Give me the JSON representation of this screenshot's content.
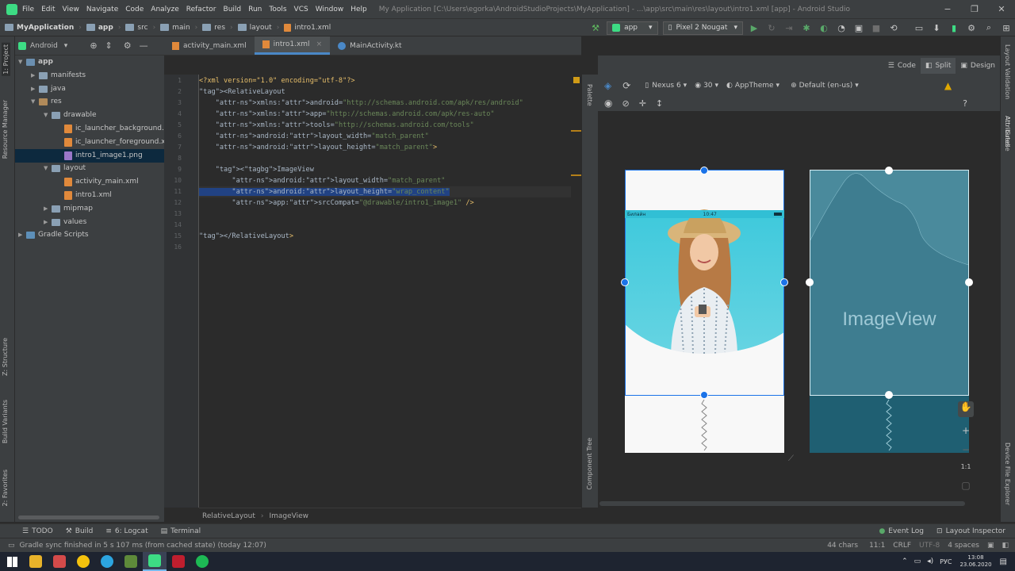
{
  "window": {
    "menu": [
      "File",
      "Edit",
      "View",
      "Navigate",
      "Code",
      "Analyze",
      "Refactor",
      "Build",
      "Run",
      "Tools",
      "VCS",
      "Window",
      "Help"
    ],
    "title": "My Application [C:\\Users\\egorka\\AndroidStudioProjects\\MyApplication] - ...\\app\\src\\main\\res\\layout\\intro1.xml [app] - Android Studio",
    "controls": {
      "minimize": "−",
      "maximize": "❐",
      "close": "✕"
    }
  },
  "navbar": {
    "breadcrumb": [
      "MyApplication",
      "app",
      "src",
      "main",
      "res",
      "layout",
      "intro1.xml"
    ],
    "run_config": "app",
    "device": "Pixel 2 Nougat"
  },
  "left_toolwindows": [
    "1: Project",
    "Resource Manager",
    "Z: Structure",
    "Build Variants",
    "2: Favorites"
  ],
  "right_toolwindows": [
    "Layout Validation",
    "Attributes",
    "Gradle",
    "Device File Explorer"
  ],
  "project": {
    "view": "Android",
    "tree": [
      {
        "label": "app",
        "depth": 0,
        "expanded": true,
        "kind": "module"
      },
      {
        "label": "manifests",
        "depth": 1,
        "expanded": false,
        "kind": "folder"
      },
      {
        "label": "java",
        "depth": 1,
        "expanded": false,
        "kind": "folder"
      },
      {
        "label": "res",
        "depth": 1,
        "expanded": true,
        "kind": "res"
      },
      {
        "label": "drawable",
        "depth": 2,
        "expanded": true,
        "kind": "folder"
      },
      {
        "label": "ic_launcher_background.xml",
        "depth": 3,
        "kind": "xml"
      },
      {
        "label": "ic_launcher_foreground.xml",
        "depth": 3,
        "kind": "xml"
      },
      {
        "label": "intro1_image1.png",
        "depth": 3,
        "kind": "png",
        "selected": true
      },
      {
        "label": "layout",
        "depth": 2,
        "expanded": true,
        "kind": "folder"
      },
      {
        "label": "activity_main.xml",
        "depth": 3,
        "kind": "xml"
      },
      {
        "label": "intro1.xml",
        "depth": 3,
        "kind": "xml"
      },
      {
        "label": "mipmap",
        "depth": 2,
        "expanded": false,
        "kind": "folder"
      },
      {
        "label": "values",
        "depth": 2,
        "expanded": false,
        "kind": "folder"
      },
      {
        "label": "Gradle Scripts",
        "depth": 0,
        "expanded": false,
        "kind": "gradle"
      }
    ]
  },
  "editor_tabs": [
    {
      "label": "activity_main.xml",
      "active": false
    },
    {
      "label": "intro1.xml",
      "active": true
    },
    {
      "label": "MainActivity.kt",
      "active": false
    }
  ],
  "code": {
    "line_numbers": [
      "1",
      "2",
      "3",
      "4",
      "5",
      "6",
      "7",
      "8",
      "9",
      "10",
      "11",
      "12",
      "13",
      "14",
      "15",
      "16"
    ],
    "lines": [
      "<?xml version=\"1.0\" encoding=\"utf-8\"?>",
      "<RelativeLayout",
      "    xmlns:android=\"http://schemas.android.com/apk/res/android\"",
      "    xmlns:app=\"http://schemas.android.com/apk/res-auto\"",
      "    xmlns:tools=\"http://schemas.android.com/tools\"",
      "    android:layout_width=\"match_parent\"",
      "    android:layout_height=\"match_parent\">",
      "",
      "    <ImageView",
      "        android:layout_width=\"match_parent\"",
      "        android:layout_height=\"wrap_content\"",
      "        app:srcCompat=\"@drawable/intro1_image1\" />",
      "",
      "",
      "</RelativeLayout>",
      ""
    ]
  },
  "editor_breadcrumb": [
    "RelativeLayout",
    "ImageView"
  ],
  "design": {
    "modes": [
      "Code",
      "Split",
      "Design"
    ],
    "active_mode": "Split",
    "toolbar": {
      "device": "Nexus 6",
      "api": "30",
      "theme": "AppTheme",
      "locale": "Default (en-us)"
    },
    "strips": {
      "palette": "Palette",
      "component_tree": "Component Tree"
    },
    "phone_status": {
      "carrier": "Билайн",
      "time": "10:47"
    },
    "blueprint_label": "ImageView",
    "zoom_controls": [
      "+",
      "−",
      "1:1"
    ]
  },
  "bottom_tools": [
    "TODO",
    "Build",
    "6: Logcat",
    "Terminal"
  ],
  "bottom_right_tools": [
    "Event Log",
    "Layout Inspector"
  ],
  "status": {
    "message": "Gradle sync finished in 5 s 107 ms (from cached state) (today 12:07)",
    "chars": "44 chars",
    "position": "11:1",
    "line_sep": "CRLF",
    "encoding": "UTF-8",
    "indent": "4 spaces"
  },
  "taskbar": {
    "lang": "РУС",
    "time": "13:08",
    "date": "23.06.2020"
  },
  "colors": {
    "accent": "#4a88c7",
    "selection": "#214283",
    "blueprint": "#1f5f72",
    "android_green": "#3ddc84"
  }
}
